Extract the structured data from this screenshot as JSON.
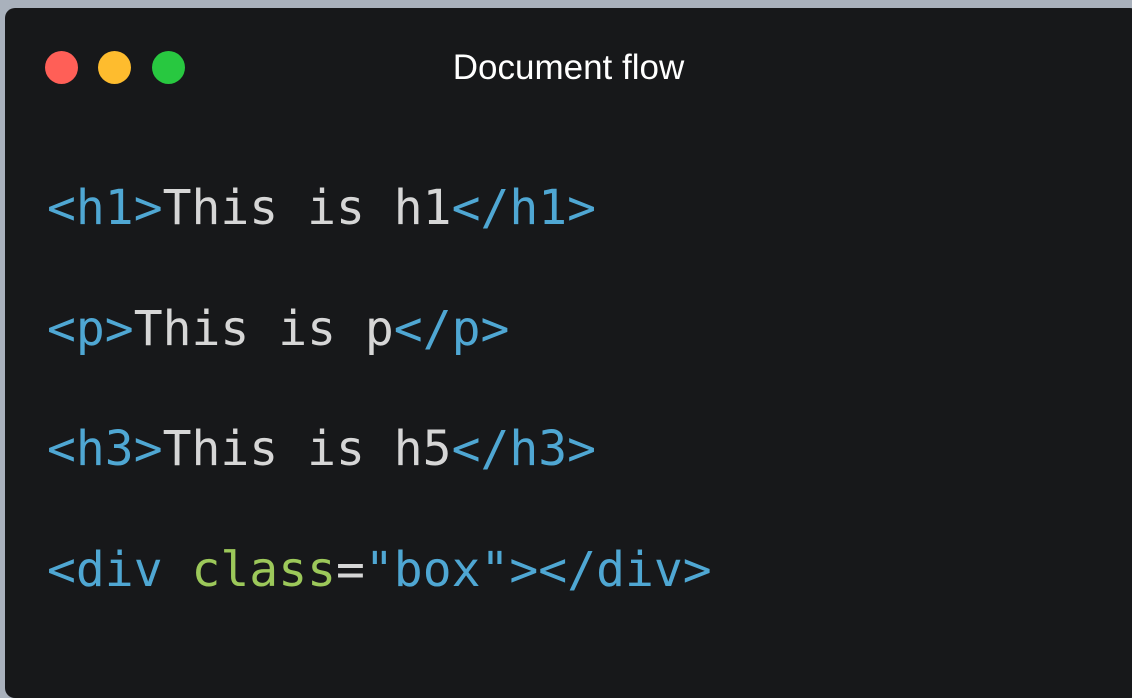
{
  "window": {
    "title": "Document flow",
    "controls": [
      "close",
      "minimize",
      "maximize"
    ],
    "colors": {
      "background": "#17181a",
      "close": "#ff5f57",
      "minimize": "#febc2e",
      "maximize": "#28c840"
    }
  },
  "code": {
    "colors": {
      "tag": "#4fa7d3",
      "text": "#d6d6d6",
      "attribute": "#9cc85a",
      "string": "#4fa7d3"
    },
    "lines": [
      {
        "open": "<h1>",
        "text": "This is h1",
        "close": "</h1>"
      },
      {
        "open": "<p>",
        "text": "This is p",
        "close": "</p>"
      },
      {
        "open": "<h3>",
        "text": "This is h5",
        "close": "</h3>"
      },
      {
        "tag_start": "<div ",
        "attr_name": "class",
        "equals": "=",
        "attr_value": "\"box\"",
        "tag_end": "></div>"
      }
    ]
  }
}
